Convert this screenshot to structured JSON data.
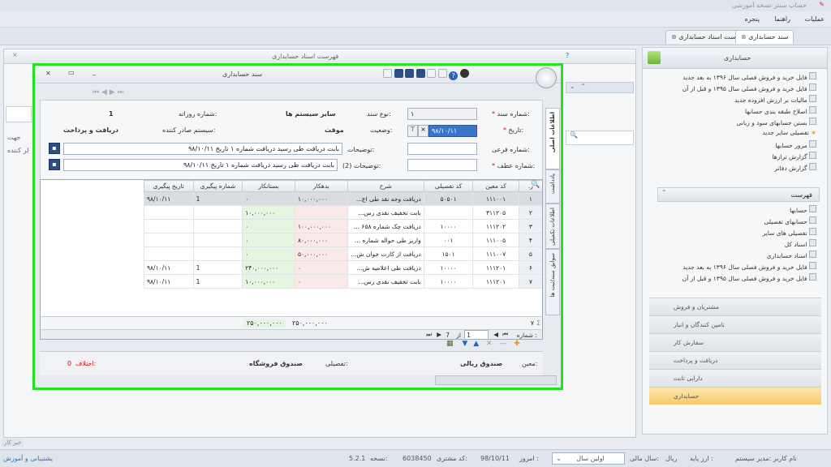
{
  "app_title": "حساب سنتر نسخه آموزشی",
  "menu": [
    "عملیات",
    "راهنما",
    "پنجره"
  ],
  "doc_tabs": [
    "فهرست اسناد حسابداری",
    "سند حسابداری"
  ],
  "bg_window_title": "فهرست اسناد حسابداری",
  "bg_fields": {
    "search_label": "جهت",
    "col_label": "لر کننده"
  },
  "right_panel": {
    "title": "حسابداری",
    "items": [
      "فایل خرید و فروش فصلی سال ۱۳۹۶ به بعد جدید",
      "فایل خرید و فروش فصلی سال ۱۳۹۵ و قبل از آن",
      "مالیات بر ارزش افزوده جدید",
      "اصلاح طبقه بندی حسابها",
      "بستن حسابهای سود و زیانی",
      "تفصیلی سایر جدید",
      "مرور حسابها",
      "گزارش ترازها",
      "گزارش دفاتر"
    ],
    "list_title": "فهرست",
    "list_items": [
      "حسابها",
      "حسابهای تفصیلی",
      "تفصیلی های سایر",
      "اسناد کل",
      "اسناد حسابداری",
      "فایل خرید و فروش فصلی سال ۱۳۹۶ به بعد جدید",
      "فایل خرید و فروش فصلی سال ۱۳۹۵ و قبل از آن"
    ],
    "nav": [
      "مشتریان و فروش",
      "تامین کنندگان و انبار",
      "سفارش کار",
      "دریافت و پرداخت",
      "دارایی ثابت",
      "حسابداری"
    ]
  },
  "dialog": {
    "title": "سند حسابداری",
    "form": {
      "doc_no_label": "شماره سند:",
      "doc_no": "۱",
      "doc_type_label": "نوع سند:",
      "doc_type": "سایر سیستم ها",
      "daily_no_label": "شماره روزانه:",
      "daily_no": "1",
      "date_label": "تاریخ:",
      "date": "۹۸/۱۰/۱۱",
      "status_label": "وضعیت:",
      "status": "موقت",
      "issuer_label": "سیستم صادر کننده:",
      "issuer": "دریافت و پرداخت",
      "sub_no_label": "شماره فرعی:",
      "sub_no": "",
      "desc_label": "توضیحات:",
      "desc": "بابت دریافت طی رسید دریافت شماره ۱ تاریخ ۹۸/۱۰/۱۱",
      "ref_no_label": "شماره عطف:",
      "ref_no": "",
      "desc2_label": "توضیحات (2):",
      "desc2": "بابت دریافت طی رسید دریافت شماره ۱ تاریخ ۹۸/۱۰/۱۱"
    },
    "side_tabs": [
      "اطلاعات اصلی",
      "یادداشت",
      "اطلاعات تکمیلی",
      "سوابق سند/ثبت ها"
    ],
    "grid": {
      "headers": [
        "ر.",
        "کد معین",
        "کد تفصیلی",
        "شرح",
        "بدهکار",
        "بستانکار",
        "شماره پیگیری",
        "تاریخ پیگیری"
      ],
      "rows": [
        [
          "۱",
          "۱۱۱۰۰۱",
          "۵۰۵۰۱",
          "دریافت وجه نقد طی اع...",
          "۱۰,۰۰۰,۰۰۰",
          "۰",
          "1",
          "۹۸/۱۰/۱۱"
        ],
        [
          "۲",
          "۳۱۱۲۰۵",
          "",
          "بابت تخفیف نقدی رس...",
          "",
          "۱۰,۰۰۰,۰۰۰",
          "",
          ""
        ],
        [
          "۳",
          "۱۱۱۲۰۲",
          "۱۰۰۰۰",
          "دریافت چک شماره ۶۵۸ ...",
          "۱۰۰,۰۰۰,۰۰۰",
          "۰",
          "",
          ""
        ],
        [
          "۴",
          "۱۱۱۰۰۵",
          "۰۰۱",
          "واریز طی حواله شماره ...",
          "۸۰,۰۰۰,۰۰۰",
          "۰",
          "",
          ""
        ],
        [
          "۵",
          "۱۱۱۰۰۷",
          "۱۵۰۱",
          "دریافت از کارت خوان ش...",
          "۵۰,۰۰۰,۰۰۰",
          "۰",
          "",
          ""
        ],
        [
          "۶",
          "۱۱۱۲۰۱",
          "۱۰۰۰۰",
          "دریافت طی اعلامیه ش...",
          "۰",
          "۲۴۰,۰۰۰,۰۰۰",
          "1",
          "۹۸/۱۰/۱۱"
        ],
        [
          "۷",
          "۱۱۱۲۰۱",
          "۱۰۰۰۰",
          "بابت تخفیف نقدی رس...",
          "۰",
          "۱۰,۰۰۰,۰۰۰",
          "1",
          "۹۸/۱۰/۱۱"
        ]
      ],
      "sum_count": "۷",
      "sum_debit": "۲۵۰,۰۰۰,۰۰۰",
      "sum_credit": "۲۵۰,۰۰۰,۰۰۰",
      "pager_label": "شماره :",
      "pager_current": "1",
      "pager_of": "از",
      "pager_total": "7"
    },
    "footer": {
      "moein_label": "معین:",
      "moein": "صندوق ریالی",
      "tafsili_label": "تفصیلی:",
      "tafsili": "صندوق فروشگاه",
      "diff_label": "اختلاف:",
      "diff": "0"
    }
  },
  "status_bar": {
    "user": "نام کاربر :مدیر سیستم",
    "currency_label": "ارز پایه :",
    "currency": "ریال",
    "fiscal_label": "سال مالی:",
    "fiscal": "اولین سال",
    "today_label": "امروز :",
    "today": "98/10/11",
    "customer_label": "کد مشتری:",
    "customer": "6038450",
    "version_label": "نسخه:",
    "version": "5.2.1",
    "support": "پشتیبانی و آموزش",
    "help_hint": "خبر کار"
  },
  "colors": {
    "highlight": "#22e322",
    "debit_bg": "#fbe8e8",
    "credit_bg": "#e4f6e2",
    "accent": "#2b4e86"
  }
}
